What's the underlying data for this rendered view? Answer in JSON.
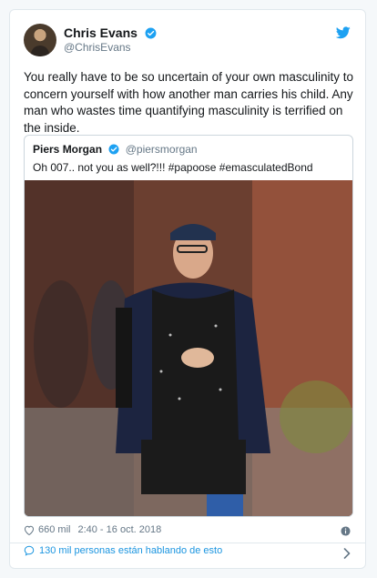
{
  "colors": {
    "accent": "#1da1f2",
    "link": "#1b95e0",
    "muted": "#657786"
  },
  "author": {
    "name": "Chris Evans",
    "handle": "@ChrisEvans",
    "verified": true,
    "avatar_icon": "avatar-icon"
  },
  "tweet": {
    "text": "You really have to be so uncertain of your own masculinity to concern yourself with how another man carries his child. Any man who wastes time quantifying masculinity is terrified on the inside."
  },
  "quoted": {
    "name": "Piers Morgan",
    "handle": "@piersmorgan",
    "verified": true,
    "text": "Oh 007.. not you as well?!!! #papoose #emasculatedBond"
  },
  "footer": {
    "likes": "660 mil",
    "timestamp": "2:40 - 16 oct. 2018",
    "conversation": "130 mil personas están hablando de esto"
  },
  "icons": [
    "twitter-bird-icon",
    "verified-icon",
    "heart-icon",
    "info-icon",
    "comment-icon",
    "chevron-right-icon"
  ]
}
